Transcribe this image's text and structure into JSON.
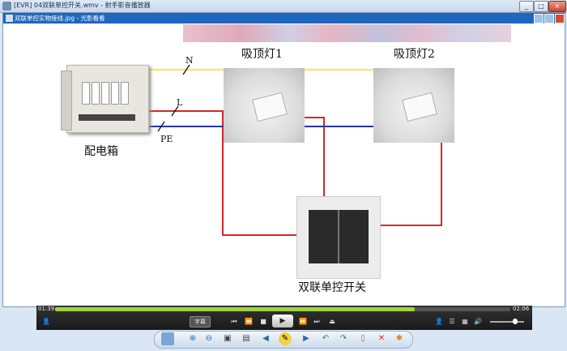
{
  "window": {
    "title": "[EVR] 04双联单控开关.wmv - 射手影音播放器",
    "min": "_",
    "max": "□",
    "close": "×"
  },
  "image_viewer": {
    "title": "双联单控实物接线.jpg - 光影看看"
  },
  "diagram": {
    "lamp1_label": "吸顶灯1",
    "lamp2_label": "吸顶灯2",
    "box_label": "配电箱",
    "switch_label": "双联单控开关",
    "wire_n": "N",
    "wire_l": "L",
    "wire_pe": "PE"
  },
  "player": {
    "elapsed": "01:39",
    "total": "02:06",
    "progress": 0.79,
    "subtitle_button": "字幕",
    "volume": 0.75
  },
  "icons": {
    "prev": "⏮",
    "rew": "⏪",
    "stop": "■",
    "play": "▶",
    "fwd": "⏩",
    "next": "⏭",
    "menu": "☰",
    "grid": "▦",
    "speaker": "🔊",
    "user": "👤",
    "open": "⏏"
  }
}
